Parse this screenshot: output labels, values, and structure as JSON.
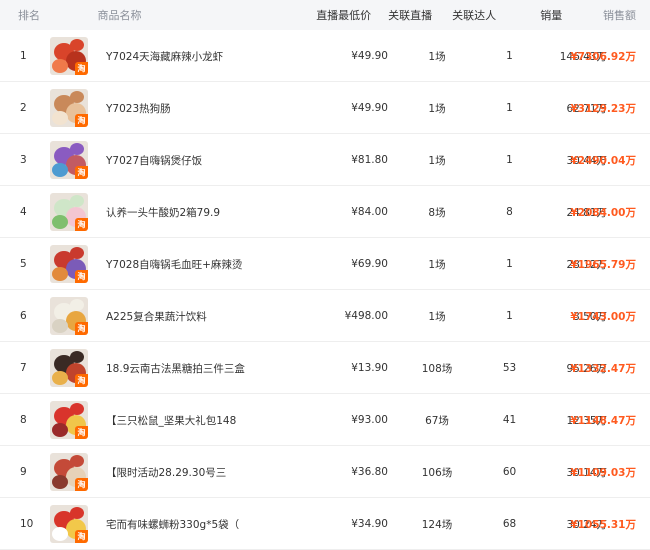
{
  "header": {
    "rank": "排名",
    "product": "商品名称",
    "min_price": "直播最低价",
    "live_count": "关联直播",
    "kol_count": "关联达人",
    "sales": "销量",
    "gmv": "销售额"
  },
  "badge_text": "淘",
  "rows": [
    {
      "rank": "1",
      "name": "Y7024天海藏麻辣小龙虾",
      "price": "¥49.90",
      "live": "1场",
      "kol": "1",
      "sales": "146.43万",
      "gmv": "¥7306.92万",
      "colors": [
        "#d9442a",
        "#b8321d",
        "#f07a4a"
      ]
    },
    {
      "rank": "2",
      "name": "Y7023热狗肠",
      "price": "¥49.90",
      "live": "1场",
      "kol": "1",
      "sales": "62.71万",
      "gmv": "¥3129.23万",
      "colors": [
        "#c9895a",
        "#e8c19a",
        "#f2e3d0"
      ]
    },
    {
      "rank": "3",
      "name": "Y7027自嗨锅煲仔饭",
      "price": "¥81.80",
      "live": "1场",
      "kol": "1",
      "sales": "30.44万",
      "gmv": "¥2490.04万",
      "colors": [
        "#8a5bc1",
        "#c25b63",
        "#4e9bd1"
      ]
    },
    {
      "rank": "4",
      "name": "认养一头牛酸奶2箱79.9",
      "price": "¥84.00",
      "live": "8场",
      "kol": "8",
      "sales": "24.81万",
      "gmv": "¥2084.00万",
      "colors": [
        "#cfe6c8",
        "#f3c6d2",
        "#7fbf6e"
      ]
    },
    {
      "rank": "5",
      "name": "Y7028自嗨锅毛血旺+麻辣烫",
      "price": "¥69.90",
      "live": "1场",
      "kol": "1",
      "sales": "28.12万",
      "gmv": "¥1965.79万",
      "colors": [
        "#c93a2e",
        "#7b5bb8",
        "#e28a3c"
      ]
    },
    {
      "rank": "6",
      "name": "A225复合果蔬汁饮料",
      "price": "¥498.00",
      "live": "1场",
      "kol": "1",
      "sales": "3.50万",
      "gmv": "¥1743.00万",
      "colors": [
        "#f2efe6",
        "#e8a640",
        "#d9d2c3"
      ]
    },
    {
      "rank": "7",
      "name": "18.9云南古法黑糖拍三件三盒",
      "price": "¥13.90",
      "live": "108场",
      "kol": "53",
      "sales": "95.26万",
      "gmv": "¥1332.47万",
      "colors": [
        "#3a2a24",
        "#c0442c",
        "#e9b04a"
      ]
    },
    {
      "rank": "8",
      "name": "【三只松鼠_坚果大礼包148",
      "price": "¥93.00",
      "live": "67场",
      "kol": "41",
      "sales": "12.35万",
      "gmv": "¥1148.47万",
      "colors": [
        "#d9342c",
        "#f0c64a",
        "#9a2a2a"
      ]
    },
    {
      "rank": "9",
      "name": "【限时活动28.29.30号三",
      "price": "¥36.80",
      "live": "106场",
      "kol": "60",
      "sales": "30.14万",
      "gmv": "¥1109.03万",
      "colors": [
        "#c44a38",
        "#e6d2b8",
        "#8a3a2e"
      ]
    },
    {
      "rank": "10",
      "name": "宅而有味螺蛳粉330g*5袋（",
      "price": "¥34.90",
      "live": "124场",
      "kol": "68",
      "sales": "30.24万",
      "gmv": "¥1055.31万",
      "colors": [
        "#d8352a",
        "#f2c84a",
        "#ffffff"
      ]
    }
  ]
}
